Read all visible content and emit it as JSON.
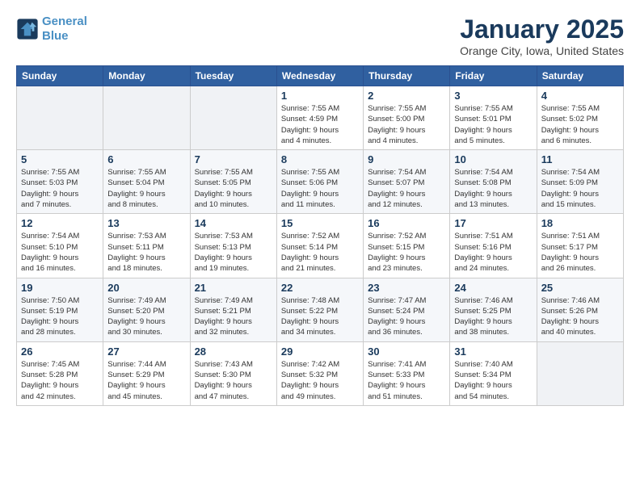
{
  "logo": {
    "line1": "General",
    "line2": "Blue"
  },
  "title": "January 2025",
  "location": "Orange City, Iowa, United States",
  "weekdays": [
    "Sunday",
    "Monday",
    "Tuesday",
    "Wednesday",
    "Thursday",
    "Friday",
    "Saturday"
  ],
  "weeks": [
    [
      {
        "day": "",
        "info": ""
      },
      {
        "day": "",
        "info": ""
      },
      {
        "day": "",
        "info": ""
      },
      {
        "day": "1",
        "info": "Sunrise: 7:55 AM\nSunset: 4:59 PM\nDaylight: 9 hours\nand 4 minutes."
      },
      {
        "day": "2",
        "info": "Sunrise: 7:55 AM\nSunset: 5:00 PM\nDaylight: 9 hours\nand 4 minutes."
      },
      {
        "day": "3",
        "info": "Sunrise: 7:55 AM\nSunset: 5:01 PM\nDaylight: 9 hours\nand 5 minutes."
      },
      {
        "day": "4",
        "info": "Sunrise: 7:55 AM\nSunset: 5:02 PM\nDaylight: 9 hours\nand 6 minutes."
      }
    ],
    [
      {
        "day": "5",
        "info": "Sunrise: 7:55 AM\nSunset: 5:03 PM\nDaylight: 9 hours\nand 7 minutes."
      },
      {
        "day": "6",
        "info": "Sunrise: 7:55 AM\nSunset: 5:04 PM\nDaylight: 9 hours\nand 8 minutes."
      },
      {
        "day": "7",
        "info": "Sunrise: 7:55 AM\nSunset: 5:05 PM\nDaylight: 9 hours\nand 10 minutes."
      },
      {
        "day": "8",
        "info": "Sunrise: 7:55 AM\nSunset: 5:06 PM\nDaylight: 9 hours\nand 11 minutes."
      },
      {
        "day": "9",
        "info": "Sunrise: 7:54 AM\nSunset: 5:07 PM\nDaylight: 9 hours\nand 12 minutes."
      },
      {
        "day": "10",
        "info": "Sunrise: 7:54 AM\nSunset: 5:08 PM\nDaylight: 9 hours\nand 13 minutes."
      },
      {
        "day": "11",
        "info": "Sunrise: 7:54 AM\nSunset: 5:09 PM\nDaylight: 9 hours\nand 15 minutes."
      }
    ],
    [
      {
        "day": "12",
        "info": "Sunrise: 7:54 AM\nSunset: 5:10 PM\nDaylight: 9 hours\nand 16 minutes."
      },
      {
        "day": "13",
        "info": "Sunrise: 7:53 AM\nSunset: 5:11 PM\nDaylight: 9 hours\nand 18 minutes."
      },
      {
        "day": "14",
        "info": "Sunrise: 7:53 AM\nSunset: 5:13 PM\nDaylight: 9 hours\nand 19 minutes."
      },
      {
        "day": "15",
        "info": "Sunrise: 7:52 AM\nSunset: 5:14 PM\nDaylight: 9 hours\nand 21 minutes."
      },
      {
        "day": "16",
        "info": "Sunrise: 7:52 AM\nSunset: 5:15 PM\nDaylight: 9 hours\nand 23 minutes."
      },
      {
        "day": "17",
        "info": "Sunrise: 7:51 AM\nSunset: 5:16 PM\nDaylight: 9 hours\nand 24 minutes."
      },
      {
        "day": "18",
        "info": "Sunrise: 7:51 AM\nSunset: 5:17 PM\nDaylight: 9 hours\nand 26 minutes."
      }
    ],
    [
      {
        "day": "19",
        "info": "Sunrise: 7:50 AM\nSunset: 5:19 PM\nDaylight: 9 hours\nand 28 minutes."
      },
      {
        "day": "20",
        "info": "Sunrise: 7:49 AM\nSunset: 5:20 PM\nDaylight: 9 hours\nand 30 minutes."
      },
      {
        "day": "21",
        "info": "Sunrise: 7:49 AM\nSunset: 5:21 PM\nDaylight: 9 hours\nand 32 minutes."
      },
      {
        "day": "22",
        "info": "Sunrise: 7:48 AM\nSunset: 5:22 PM\nDaylight: 9 hours\nand 34 minutes."
      },
      {
        "day": "23",
        "info": "Sunrise: 7:47 AM\nSunset: 5:24 PM\nDaylight: 9 hours\nand 36 minutes."
      },
      {
        "day": "24",
        "info": "Sunrise: 7:46 AM\nSunset: 5:25 PM\nDaylight: 9 hours\nand 38 minutes."
      },
      {
        "day": "25",
        "info": "Sunrise: 7:46 AM\nSunset: 5:26 PM\nDaylight: 9 hours\nand 40 minutes."
      }
    ],
    [
      {
        "day": "26",
        "info": "Sunrise: 7:45 AM\nSunset: 5:28 PM\nDaylight: 9 hours\nand 42 minutes."
      },
      {
        "day": "27",
        "info": "Sunrise: 7:44 AM\nSunset: 5:29 PM\nDaylight: 9 hours\nand 45 minutes."
      },
      {
        "day": "28",
        "info": "Sunrise: 7:43 AM\nSunset: 5:30 PM\nDaylight: 9 hours\nand 47 minutes."
      },
      {
        "day": "29",
        "info": "Sunrise: 7:42 AM\nSunset: 5:32 PM\nDaylight: 9 hours\nand 49 minutes."
      },
      {
        "day": "30",
        "info": "Sunrise: 7:41 AM\nSunset: 5:33 PM\nDaylight: 9 hours\nand 51 minutes."
      },
      {
        "day": "31",
        "info": "Sunrise: 7:40 AM\nSunset: 5:34 PM\nDaylight: 9 hours\nand 54 minutes."
      },
      {
        "day": "",
        "info": ""
      }
    ]
  ]
}
